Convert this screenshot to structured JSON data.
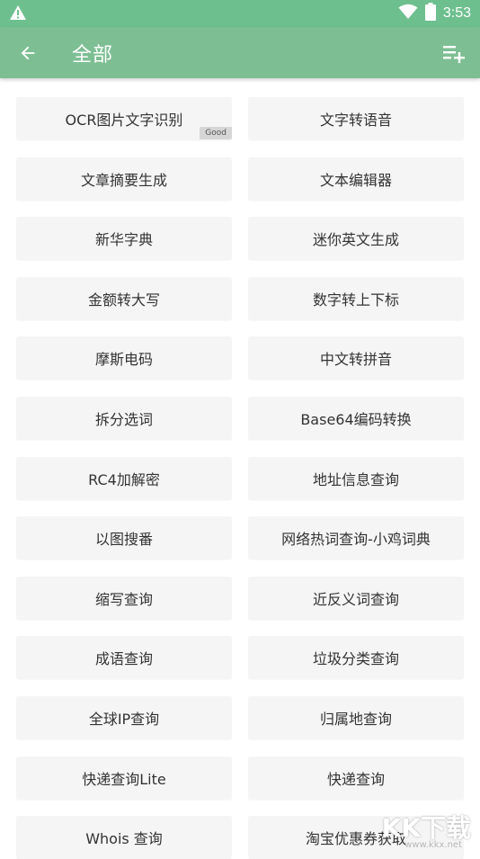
{
  "status_bar": {
    "time": "3:53",
    "icons": [
      "warning-icon",
      "wifi-icon",
      "battery-icon"
    ]
  },
  "app_bar": {
    "title": "全部",
    "back_icon": "arrow-left-icon",
    "menu_icon": "playlist-add-icon"
  },
  "colors": {
    "status_bar": "#6dbf8e",
    "app_bar": "#7dbf93",
    "tile_background": "#f5f5f5"
  },
  "tools": [
    {
      "label": "OCR图片文字识别",
      "badge": "Good"
    },
    {
      "label": "文字转语音"
    },
    {
      "label": "文章摘要生成"
    },
    {
      "label": "文本编辑器"
    },
    {
      "label": "新华字典"
    },
    {
      "label": "迷你英文生成"
    },
    {
      "label": "金额转大写"
    },
    {
      "label": "数字转上下标"
    },
    {
      "label": "摩斯电码"
    },
    {
      "label": "中文转拼音"
    },
    {
      "label": "拆分选词"
    },
    {
      "label": "Base64编码转换"
    },
    {
      "label": "RC4加解密"
    },
    {
      "label": "地址信息查询"
    },
    {
      "label": "以图搜番"
    },
    {
      "label": "网络热词查询-小鸡词典"
    },
    {
      "label": "缩写查询"
    },
    {
      "label": "近反义词查询"
    },
    {
      "label": "成语查询"
    },
    {
      "label": "垃圾分类查询"
    },
    {
      "label": "全球IP查询"
    },
    {
      "label": "归属地查询"
    },
    {
      "label": "快递查询Lite"
    },
    {
      "label": "快递查询"
    },
    {
      "label": "Whois 查询"
    },
    {
      "label": "淘宝优惠券获取"
    }
  ],
  "watermark": {
    "main": "KK下载",
    "sub": "www.kkx.net"
  }
}
